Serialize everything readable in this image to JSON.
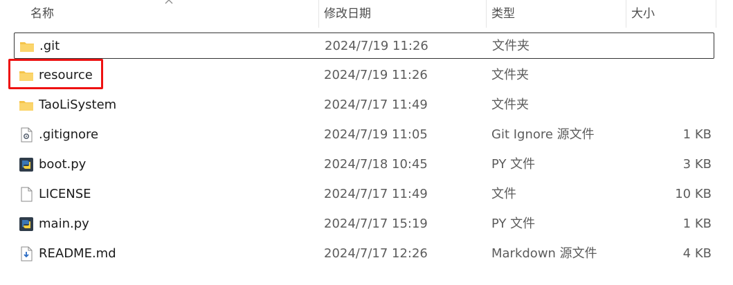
{
  "columns": {
    "name": "名称",
    "date": "修改日期",
    "type": "类型",
    "size": "大小"
  },
  "files": [
    {
      "name": ".git",
      "date": "2024/7/19 11:26",
      "type": "文件夹",
      "size": "",
      "icon": "folder-icon",
      "selected": true
    },
    {
      "name": "resource",
      "date": "2024/7/19 11:26",
      "type": "文件夹",
      "size": "",
      "icon": "folder-icon",
      "selected": false
    },
    {
      "name": "TaoLiSystem",
      "date": "2024/7/17 11:49",
      "type": "文件夹",
      "size": "",
      "icon": "folder-icon",
      "selected": false
    },
    {
      "name": ".gitignore",
      "date": "2024/7/19 11:05",
      "type": "Git Ignore 源文件",
      "size": "1 KB",
      "icon": "config-file-icon",
      "selected": false
    },
    {
      "name": "boot.py",
      "date": "2024/7/18 10:45",
      "type": "PY 文件",
      "size": "3 KB",
      "icon": "python-file-icon",
      "selected": false
    },
    {
      "name": "LICENSE",
      "date": "2024/7/17 11:49",
      "type": "文件",
      "size": "10 KB",
      "icon": "blank-file-icon",
      "selected": false
    },
    {
      "name": "main.py",
      "date": "2024/7/17 15:19",
      "type": "PY 文件",
      "size": "1 KB",
      "icon": "python-file-icon",
      "selected": false
    },
    {
      "name": "README.md",
      "date": "2024/7/17 12:26",
      "type": "Markdown 源文件",
      "size": "4 KB",
      "icon": "markdown-file-icon",
      "selected": false
    }
  ],
  "colors": {
    "highlight": "#ee1111",
    "folder": "#f5c44a",
    "selection_border": "#333333"
  }
}
